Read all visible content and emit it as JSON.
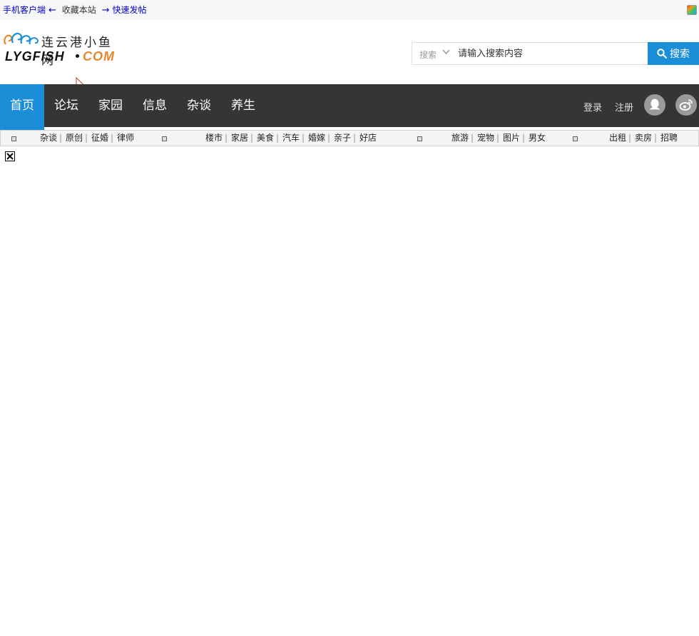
{
  "topbar": {
    "mobile_client": "手机客户端",
    "arrow_left": "←",
    "bookmark": "收藏本站",
    "arrow_right": "→",
    "quick_post": "快速发帖"
  },
  "logo": {
    "cn_text": "连云港小鱼网",
    "en_text_main": "LYGFISH",
    "en_text_suffix": "COM"
  },
  "search": {
    "type_label": "搜索",
    "placeholder": "请输入搜索内容",
    "button_label": "搜索"
  },
  "nav": {
    "items": [
      {
        "label": "首页",
        "active": true
      },
      {
        "label": "论坛"
      },
      {
        "label": "家园"
      },
      {
        "label": "信息"
      },
      {
        "label": "杂谈"
      },
      {
        "label": "养生"
      }
    ],
    "login": "登录",
    "register": "注册",
    "qq_icon": "qq-icon",
    "weibo_icon": "weibo-icon",
    "active_color": "#1a8ed6",
    "bar_color": "#353535"
  },
  "categories": {
    "group1": [
      "杂谈",
      "原创",
      "征婚",
      "律师"
    ],
    "group2": [
      "楼市",
      "家居",
      "美食",
      "汽车",
      "婚嫁",
      "亲子",
      "好店"
    ],
    "group3": [
      "旅游",
      "宠物",
      "图片",
      "男女"
    ],
    "group4": [
      "出租",
      "卖房",
      "招聘"
    ],
    "separator": "|"
  }
}
